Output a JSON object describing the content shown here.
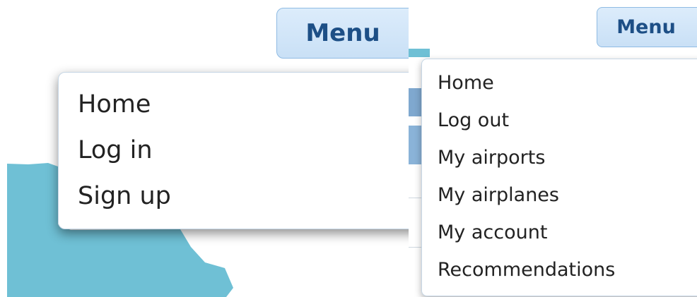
{
  "left_screen": {
    "menu_button_label": "Menu",
    "dropdown_items": [
      "Home",
      "Log in",
      "Sign up"
    ]
  },
  "right_screen": {
    "menu_button_label": "Menu",
    "dropdown_items": [
      "Home",
      "Log out",
      "My airports",
      "My airplanes",
      "My account",
      "Recommendations"
    ]
  },
  "colors": {
    "map_water": "#6fc0d5",
    "button_fill": "#d2e6f8",
    "button_border": "#8fbbe3",
    "button_text": "#1d4f86",
    "menu_text": "#222222",
    "background": "#ffffff"
  }
}
